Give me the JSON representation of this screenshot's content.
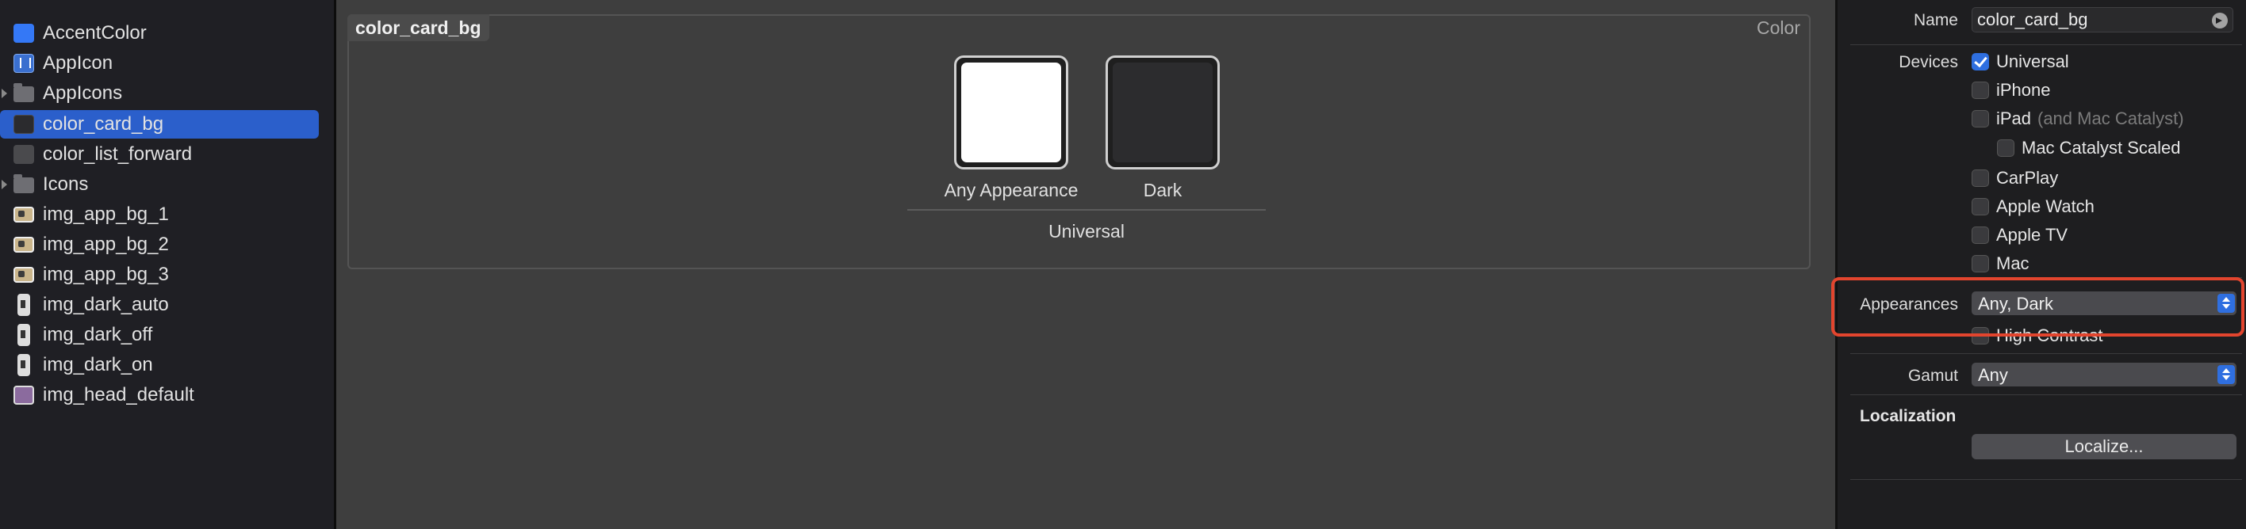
{
  "sidebar": {
    "items": [
      {
        "label": "AccentColor",
        "icon": "accent-color-icon",
        "disclosure": false
      },
      {
        "label": "AppIcon",
        "icon": "app-icon-icon",
        "disclosure": false
      },
      {
        "label": "AppIcons",
        "icon": "folder-icon",
        "disclosure": true
      },
      {
        "label": "color_card_bg",
        "icon": "color-set-icon",
        "disclosure": false,
        "selected": true
      },
      {
        "label": "color_list_forward",
        "icon": "color-set-icon",
        "disclosure": false
      },
      {
        "label": "Icons",
        "icon": "folder-icon",
        "disclosure": true
      },
      {
        "label": "img_app_bg_1",
        "icon": "image-set-icon",
        "disclosure": false
      },
      {
        "label": "img_app_bg_2",
        "icon": "image-set-icon",
        "disclosure": false
      },
      {
        "label": "img_app_bg_3",
        "icon": "image-set-icon",
        "disclosure": false
      },
      {
        "label": "img_dark_auto",
        "icon": "image-set-icon",
        "disclosure": false
      },
      {
        "label": "img_dark_off",
        "icon": "image-set-icon",
        "disclosure": false
      },
      {
        "label": "img_dark_on",
        "icon": "image-set-icon",
        "disclosure": false
      },
      {
        "label": "img_head_default",
        "icon": "image-set-icon",
        "disclosure": false
      }
    ]
  },
  "editor": {
    "group_title": "color_card_bg",
    "group_kind": "Color",
    "wells": [
      {
        "label": "Any Appearance",
        "color": "#ffffff"
      },
      {
        "label": "Dark",
        "color": "#2c2c2e"
      }
    ],
    "device_label": "Universal"
  },
  "inspector": {
    "name_label": "Name",
    "name_value": "color_card_bg",
    "devices_label": "Devices",
    "devices": [
      {
        "label": "Universal",
        "checked": true
      },
      {
        "label": "iPhone",
        "checked": false
      },
      {
        "label": "iPad",
        "checked": false,
        "note": "(and Mac Catalyst)"
      },
      {
        "label": "Mac Catalyst Scaled",
        "checked": false
      },
      {
        "label": "CarPlay",
        "checked": false
      },
      {
        "label": "Apple Watch",
        "checked": false
      },
      {
        "label": "Apple TV",
        "checked": false
      },
      {
        "label": "Mac",
        "checked": false
      }
    ],
    "appearances_label": "Appearances",
    "appearances_value": "Any, Dark",
    "high_contrast_label": "High Contrast",
    "gamut_label": "Gamut",
    "gamut_value": "Any",
    "localization_label": "Localization",
    "localize_button": "Localize..."
  },
  "colors": {
    "selection": "#2b5fcb",
    "highlight_box": "#e3452e",
    "accent_blue": "#2f6fe0"
  }
}
